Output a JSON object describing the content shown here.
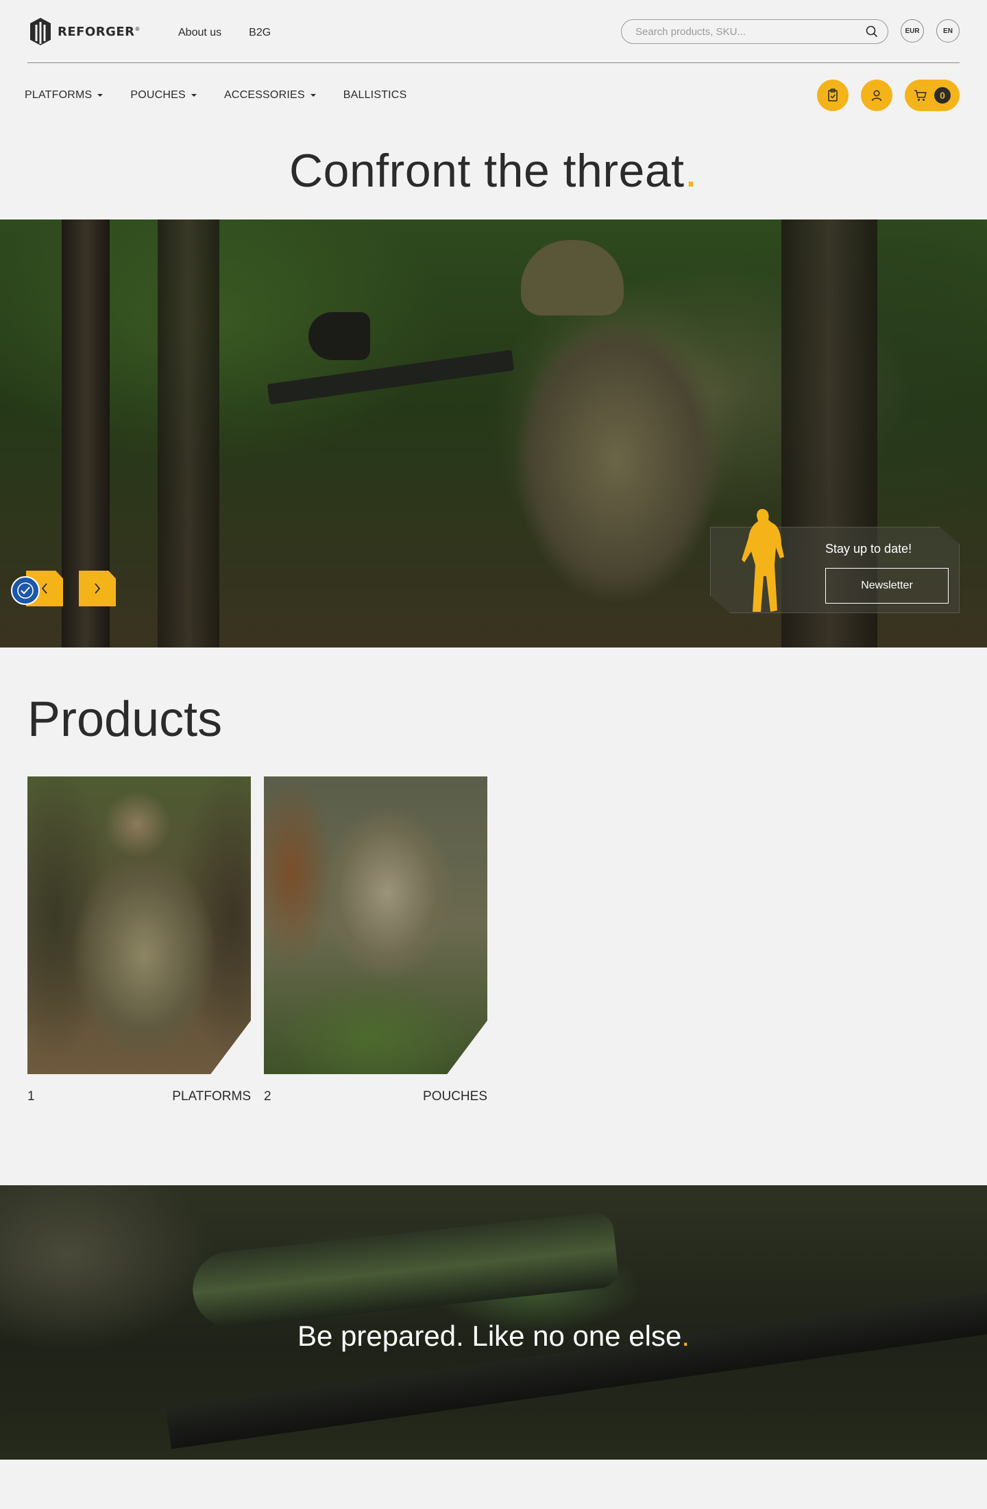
{
  "header": {
    "logo_text": "REFORGER",
    "logo_mark": "®",
    "links": [
      "About us",
      "B2G"
    ],
    "search_placeholder": "Search products, SKU...",
    "currency": "EUR",
    "language": "EN"
  },
  "nav": {
    "items": [
      {
        "label": "PLATFORMS",
        "has_dropdown": true
      },
      {
        "label": "POUCHES",
        "has_dropdown": true
      },
      {
        "label": "ACCESSORIES",
        "has_dropdown": true
      },
      {
        "label": "BALLISTICS",
        "has_dropdown": false
      }
    ],
    "cart_count": "0"
  },
  "hero": {
    "title": "Confront the threat",
    "title_dot": ".",
    "newsletter_text": "Stay up to date!",
    "newsletter_button": "Newsletter"
  },
  "products": {
    "title": "Products",
    "cards": [
      {
        "number": "1",
        "label": "PLATFORMS"
      },
      {
        "number": "2",
        "label": "POUCHES"
      }
    ]
  },
  "banner": {
    "text": "Be prepared. Like no one else",
    "dot": "."
  },
  "colors": {
    "accent": "#f5b31a",
    "text": "#2b2b2b",
    "background": "#f2f2f2",
    "accessibility": "#1c57a8"
  },
  "icons": [
    "logo-icon",
    "search-icon",
    "clipboard-icon",
    "user-icon",
    "cart-icon",
    "chevron-left-icon",
    "chevron-right-icon",
    "accessibility-icon",
    "soldier-silhouette-icon"
  ]
}
